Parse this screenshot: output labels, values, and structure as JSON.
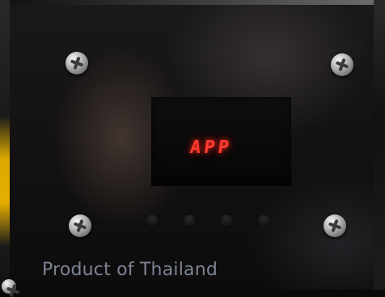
{
  "device": {
    "display_text": "APP",
    "label_text": "Product of Thailand"
  },
  "colors": {
    "display_red": "#ff3b2f",
    "label_gray": "#7d8495",
    "edge_yellow": "#f0b600"
  }
}
